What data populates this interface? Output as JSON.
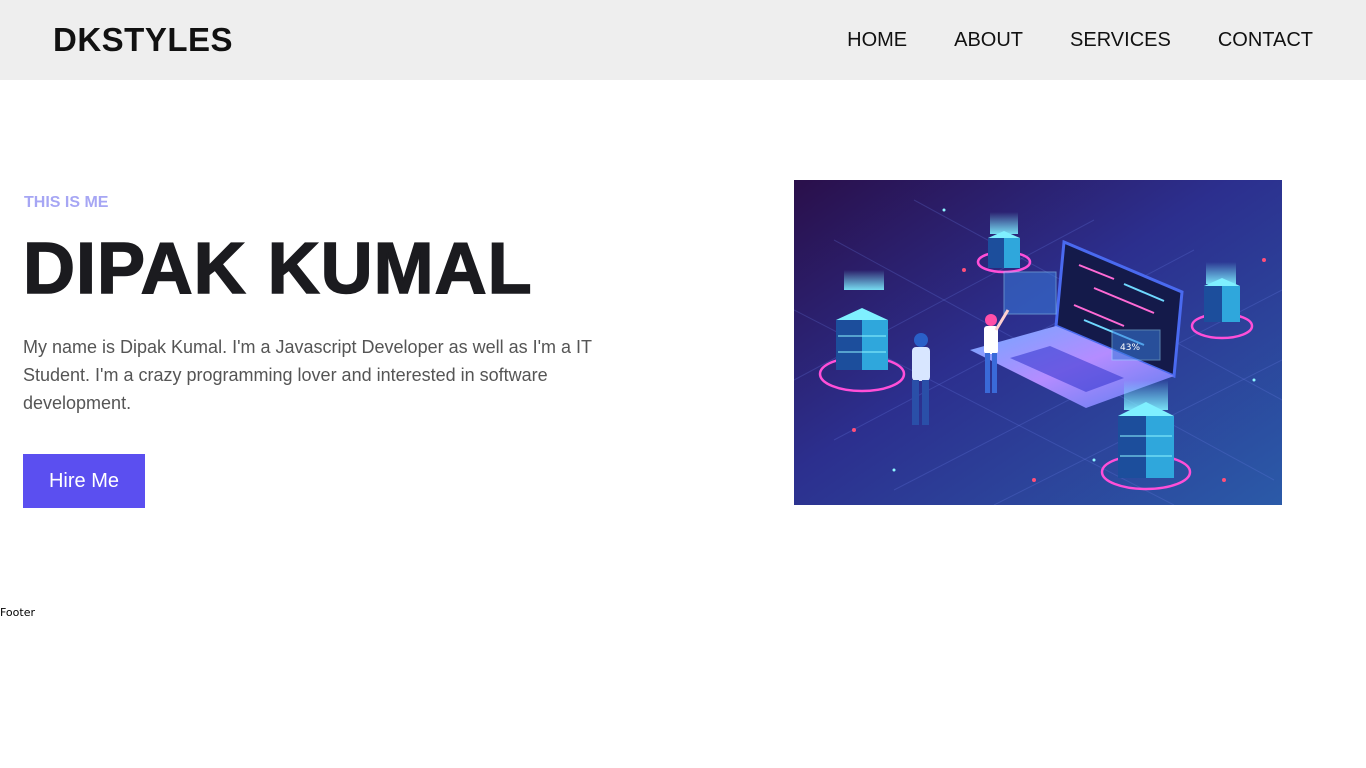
{
  "header": {
    "logo": "DKSTYLES",
    "nav": [
      {
        "label": "HOME"
      },
      {
        "label": "ABOUT"
      },
      {
        "label": "SERVICES"
      },
      {
        "label": "CONTACT"
      }
    ]
  },
  "hero": {
    "subtitle": "THIS IS ME",
    "title": "DIPAK KUMAL",
    "description": "My name is Dipak Kumal. I'm a Javascript Developer as well as I'm a IT Student. I'm a crazy programming lover and interested in software development.",
    "button_label": "Hire Me",
    "image": {
      "icon": "isometric-server-laptop-illustration",
      "screen_percent": "43%"
    }
  },
  "footer": {
    "text": "Footer"
  },
  "colors": {
    "nav_background": "#eeeeee",
    "accent": "#5b4ff0",
    "subtitle": "#a6a6f4",
    "title": "#1b1b1f",
    "body_text": "#555555"
  }
}
